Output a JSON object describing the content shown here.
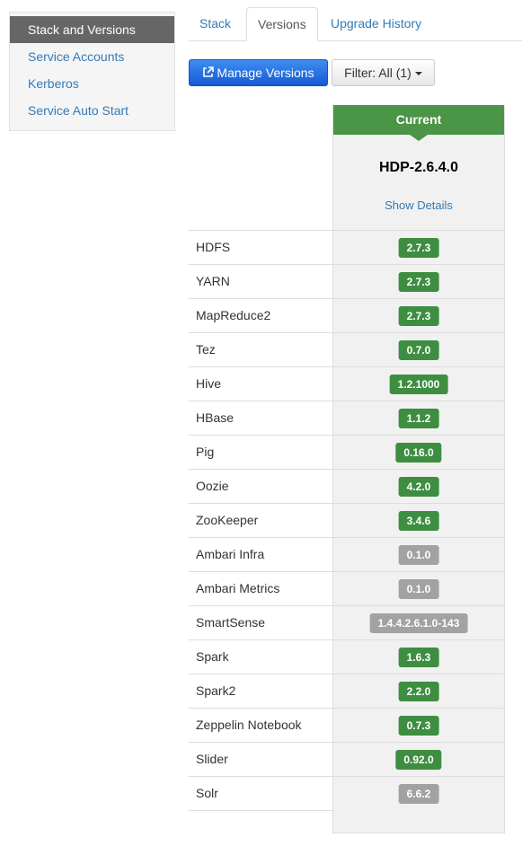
{
  "sidebar": {
    "items": [
      {
        "label": "Stack and Versions"
      },
      {
        "label": "Service Accounts"
      },
      {
        "label": "Kerberos"
      },
      {
        "label": "Service Auto Start"
      }
    ]
  },
  "tabs": [
    {
      "label": "Stack"
    },
    {
      "label": "Versions"
    },
    {
      "label": "Upgrade History"
    }
  ],
  "toolbar": {
    "manage_label": "Manage Versions",
    "filter_label": "Filter: All (1)"
  },
  "version_column": {
    "status": "Current",
    "name": "HDP-2.6.4.0",
    "details_link": "Show Details",
    "accent_color": "#4a9546"
  },
  "services": [
    {
      "name": "HDFS",
      "version": "2.7.3",
      "state": "green"
    },
    {
      "name": "YARN",
      "version": "2.7.3",
      "state": "green"
    },
    {
      "name": "MapReduce2",
      "version": "2.7.3",
      "state": "green"
    },
    {
      "name": "Tez",
      "version": "0.7.0",
      "state": "green"
    },
    {
      "name": "Hive",
      "version": "1.2.1000",
      "state": "green"
    },
    {
      "name": "HBase",
      "version": "1.1.2",
      "state": "green"
    },
    {
      "name": "Pig",
      "version": "0.16.0",
      "state": "green"
    },
    {
      "name": "Oozie",
      "version": "4.2.0",
      "state": "green"
    },
    {
      "name": "ZooKeeper",
      "version": "3.4.6",
      "state": "green"
    },
    {
      "name": "Ambari Infra",
      "version": "0.1.0",
      "state": "gray"
    },
    {
      "name": "Ambari Metrics",
      "version": "0.1.0",
      "state": "gray"
    },
    {
      "name": "SmartSense",
      "version": "1.4.4.2.6.1.0-143",
      "state": "gray"
    },
    {
      "name": "Spark",
      "version": "1.6.3",
      "state": "green"
    },
    {
      "name": "Spark2",
      "version": "2.2.0",
      "state": "green"
    },
    {
      "name": "Zeppelin Notebook",
      "version": "0.7.3",
      "state": "green"
    },
    {
      "name": "Slider",
      "version": "0.92.0",
      "state": "green"
    },
    {
      "name": "Solr",
      "version": "6.6.2",
      "state": "gray"
    }
  ]
}
